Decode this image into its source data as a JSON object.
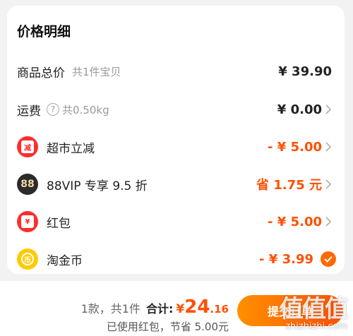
{
  "card": {
    "title": "价格明细",
    "rows": {
      "goods_total": {
        "label": "商品总价",
        "sub": "共1件宝贝",
        "value": "¥ 39.90"
      },
      "shipping": {
        "label": "运费",
        "help": "?",
        "sub": "共0.50kg",
        "value": "¥ 0.00"
      },
      "market_discount": {
        "label": "超市立减",
        "icon_text": "减",
        "value": "- ¥ 5.00"
      },
      "vip": {
        "label": "88VIP 专享 9.5 折",
        "icon_text": "88",
        "value": "省 1.75 元"
      },
      "red_packet": {
        "label": "红包",
        "icon_text": "¥",
        "value": "- ¥ 5.00"
      },
      "taojinbi": {
        "label": "淘金币",
        "icon_text": "币",
        "value": "- ¥ 3.99"
      }
    }
  },
  "footer": {
    "count": "1款，共1件",
    "total_label": "合计:",
    "total_currency": "¥",
    "total_int": "24",
    "total_dec": ".16",
    "saved": "已使用红包，节省 5.00元",
    "submit_label": "提交订单"
  },
  "watermark": {
    "big": "值值值",
    "small": "zhizhizhi.com"
  },
  "icons": {
    "help": "question-circle-icon",
    "chevron": "chevron-right-icon",
    "check": "check-circle-icon"
  },
  "colors": {
    "accent": "#ff5000",
    "button_start": "#ff9000",
    "button_end": "#ff5000",
    "vip_bg": "#2b2b2b",
    "coin": "#ffcb00"
  }
}
